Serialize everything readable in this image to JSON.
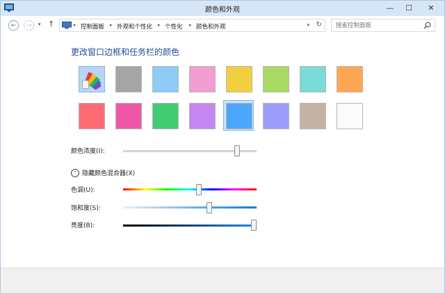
{
  "window": {
    "title": "颜色和外观",
    "minimize": "—",
    "maximize": "☐",
    "close": "✕"
  },
  "address": {
    "back": "←",
    "forward": "→",
    "recent": "▾",
    "up": "↑",
    "breadcrumbs": [
      "控制面板",
      "外观和个性化",
      "个性化",
      "颜色和外观"
    ],
    "separator": "▸",
    "dropdown": "▾",
    "refresh": "↻",
    "search_placeholder": "搜索控制面板"
  },
  "content": {
    "heading": "更改窗口边框和任务栏的颜色",
    "swatches": [
      {
        "color": "auto",
        "icon": "color-palette-icon"
      },
      {
        "color": "#a5a5a5"
      },
      {
        "color": "#8ecbf7"
      },
      {
        "color": "#f29dd2"
      },
      {
        "color": "#f0d03e"
      },
      {
        "color": "#a8d963"
      },
      {
        "color": "#7adcd6"
      },
      {
        "color": "#fca853"
      },
      {
        "color": "#fd6c73"
      },
      {
        "color": "#f156a7"
      },
      {
        "color": "#44cc73"
      },
      {
        "color": "#c487f2"
      },
      {
        "color": "#4ca6fb"
      },
      {
        "color": "#9c9dfa"
      },
      {
        "color": "#c4b3a5"
      },
      {
        "color": "#fbfbfb"
      }
    ],
    "selected_swatch": 12,
    "intensity_label": "颜色浓度(I):",
    "intensity_value": 0.87,
    "mixer_toggle": "隐藏颜色混合器(X)",
    "mixer_toggle_icon": "⌃",
    "hue_label": "色调(U):",
    "hue_value": 0.57,
    "saturation_label": "饱和度(S):",
    "saturation_value": 0.65,
    "brightness_label": "亮度(B):",
    "brightness_value": 1.0,
    "accent_color": "#4ca6fb"
  }
}
